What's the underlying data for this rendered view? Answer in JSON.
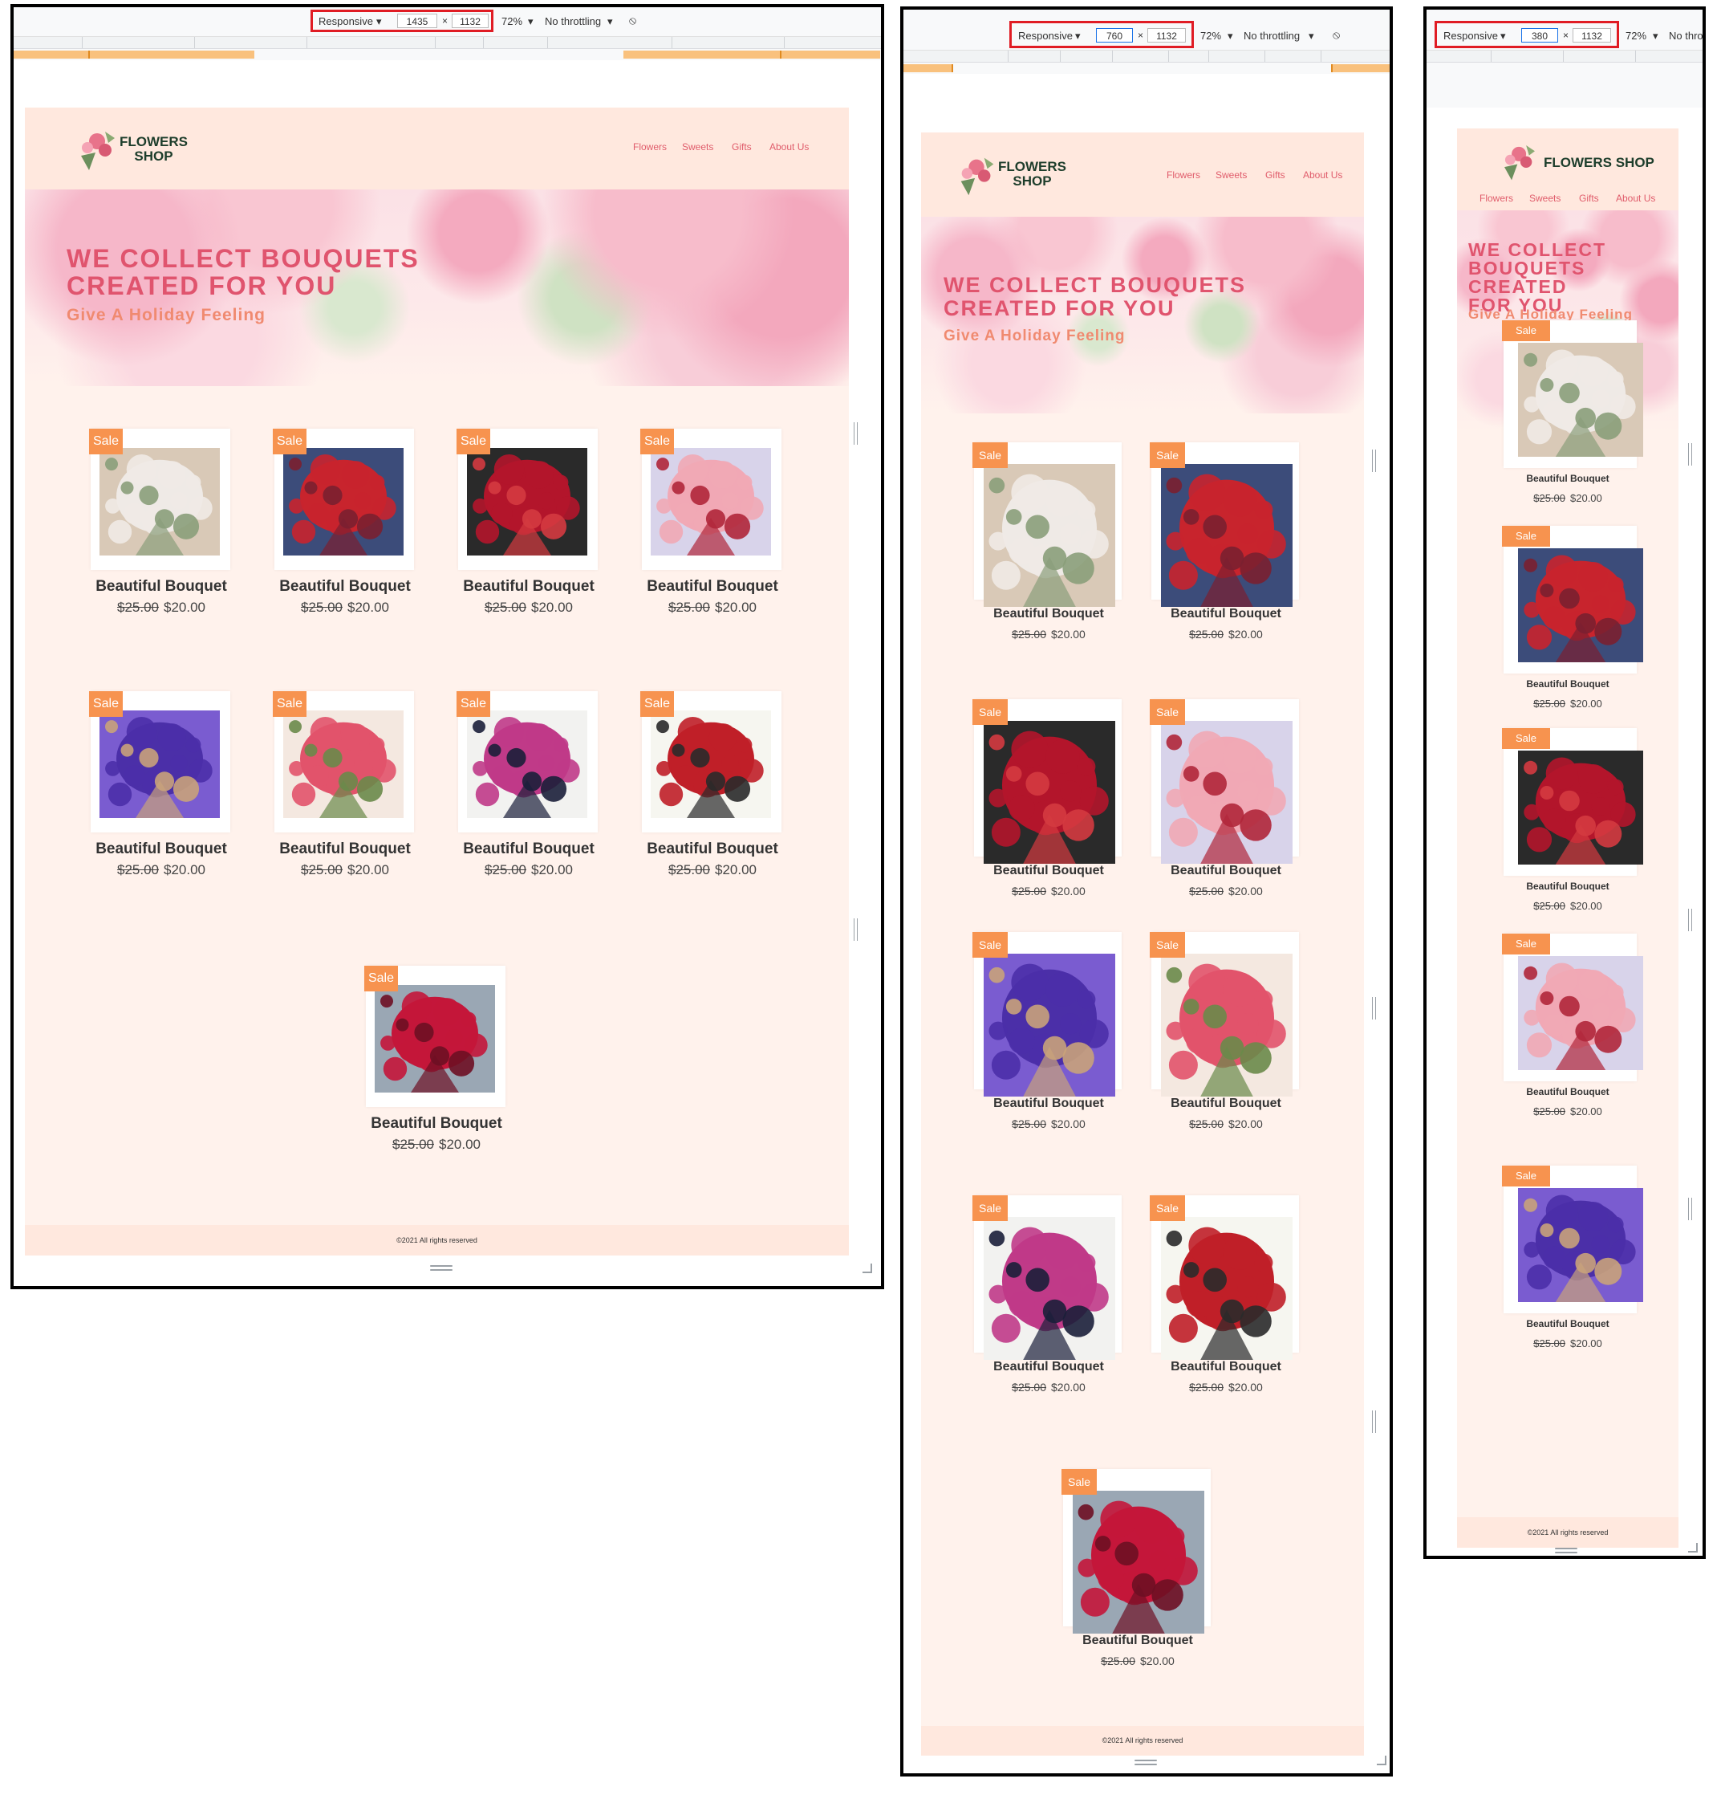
{
  "devtools": {
    "mode": "Responsive",
    "zoom": "72%",
    "throttle": "No throttling",
    "height": "1132",
    "views": [
      {
        "width": "1435"
      },
      {
        "width": "760"
      },
      {
        "width": "380"
      }
    ]
  },
  "site": {
    "logo_line1": "FLOWERS",
    "logo_line2": "SHOP",
    "logo_full": "FLOWERS SHOP",
    "nav": [
      "Flowers",
      "Sweets",
      "Gifts",
      "About Us"
    ],
    "hero_title": "WE COLLECT BOUQUETS CREATED FOR YOU",
    "hero_title_l1": "WE COLLECT BOUQUETS",
    "hero_title_l2": "CREATED FOR YOU",
    "hero_s_l1": "WE COLLECT",
    "hero_s_l2": "BOUQUETS CREATED",
    "hero_s_l3": "FOR YOU",
    "hero_subtitle": "Give A Holiday Feeling",
    "badge": "Sale",
    "product_name": "Beautiful Bouquet",
    "old_price": "$25.00",
    "new_price": "$20.00",
    "footer": "©2021 All rights reserved"
  },
  "products": [
    {
      "photo": "dried-bouquet-with-scissors",
      "colors": [
        "#efeae6",
        "#d9c9b7",
        "#8a9e7a"
      ]
    },
    {
      "photo": "strawberry-bouquet",
      "colors": [
        "#c8242d",
        "#3c4c7a",
        "#7a2030"
      ]
    },
    {
      "photo": "red-roses-bouquet",
      "colors": [
        "#b3152b",
        "#2a2a2a",
        "#d43a40"
      ]
    },
    {
      "photo": "pink-roses-box-with-sweets",
      "colors": [
        "#f1a8b5",
        "#d8d3ea",
        "#b0263a"
      ]
    },
    {
      "photo": "purple-iris-bouquet",
      "colors": [
        "#4b2fa8",
        "#7a5cd0",
        "#c9a27a"
      ]
    },
    {
      "photo": "mixed-tulips-bouquet",
      "colors": [
        "#e2536b",
        "#f4e8e0",
        "#6a8a4a"
      ]
    },
    {
      "photo": "heart-of-roses",
      "colors": [
        "#c03a88",
        "#f2f2f0",
        "#1b1f3a"
      ]
    },
    {
      "photo": "heart-box-strawberries-daisies",
      "colors": [
        "#c01f28",
        "#f6f6f0",
        "#2a2a2a"
      ]
    },
    {
      "photo": "big-red-roses-bouquet",
      "colors": [
        "#c4163a",
        "#9aa7b4",
        "#6e0f24"
      ]
    }
  ]
}
